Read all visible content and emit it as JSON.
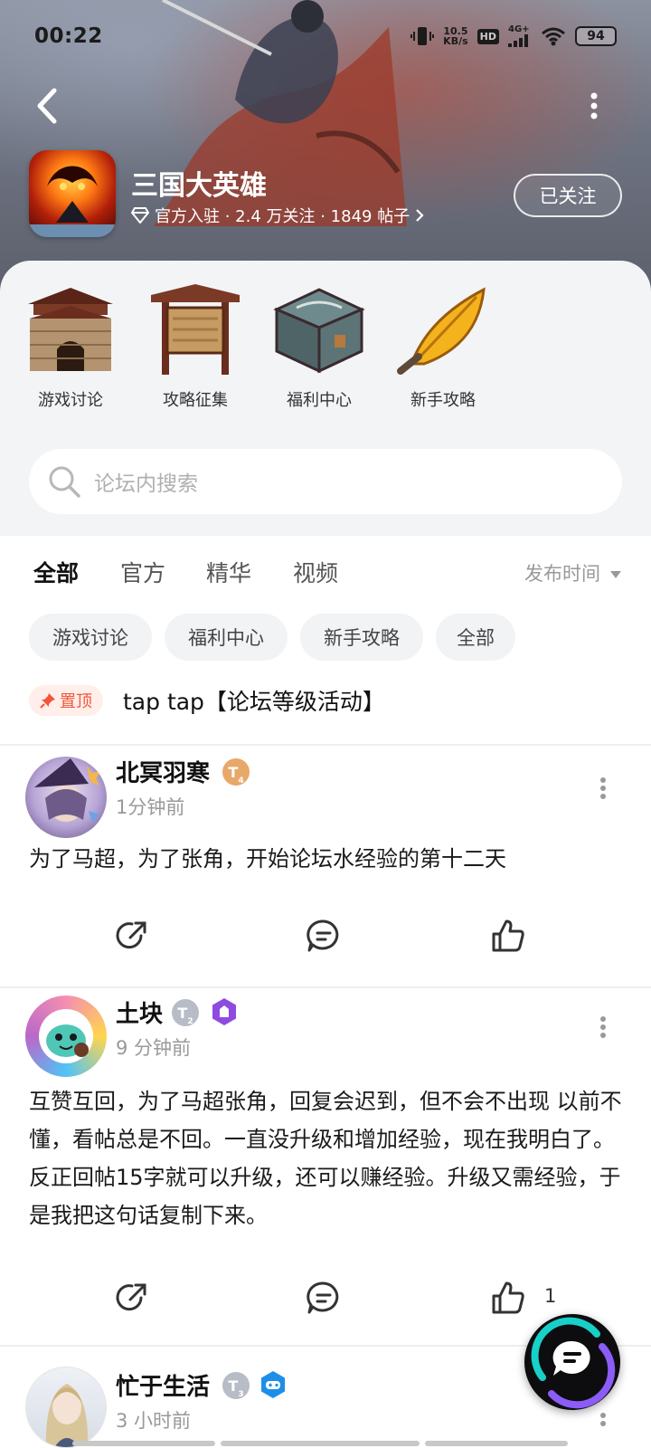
{
  "status_bar": {
    "time": "00:22",
    "net_speed_value": "10.5",
    "net_speed_unit": "KB/s",
    "hd_label": "HD",
    "signal_label": "4G+",
    "battery": "94"
  },
  "forum": {
    "title": "三国大英雄",
    "meta": "官方入驻 · 2.4 万关注 · 1849 帖子",
    "follow_label": "已关注"
  },
  "quick_links": [
    {
      "label": "游戏讨论",
      "icon": "city-gate-icon"
    },
    {
      "label": "攻略征集",
      "icon": "notice-board-icon"
    },
    {
      "label": "福利中心",
      "icon": "treasure-chest-icon"
    },
    {
      "label": "新手攻略",
      "icon": "golden-feather-icon"
    }
  ],
  "search": {
    "placeholder": "论坛内搜索"
  },
  "tabs": [
    {
      "label": "全部",
      "active": true
    },
    {
      "label": "官方",
      "active": false
    },
    {
      "label": "精华",
      "active": false
    },
    {
      "label": "视频",
      "active": false
    }
  ],
  "sort_label": "发布时间",
  "filter_chips": [
    "游戏讨论",
    "福利中心",
    "新手攻略",
    "全部"
  ],
  "pinned": {
    "badge": "置顶",
    "title": "tap tap【论坛等级活动】"
  },
  "posts": [
    {
      "author": "北冥羽寒",
      "level": "T",
      "level_num": "4",
      "time": "1分钟前",
      "body": "为了马超，为了张角，开始论坛水经验的第十二天",
      "likes": ""
    },
    {
      "author": "土块",
      "level": "T",
      "level_num": "2",
      "time": "9 分钟前",
      "body": "互赞互回，为了马超张角，回复会迟到，但不会不出现 以前不懂，看帖总是不回。一直没升级和增加经验，现在我明白了。反正回帖15字就可以升级，还可以赚经验。升级又需经验，于是我把这句话复制下来。",
      "likes": "1"
    },
    {
      "author": "忙于生活",
      "level": "T",
      "level_num": "3",
      "time": "3 小时前",
      "body": "",
      "likes": ""
    }
  ],
  "colors": {
    "accent": "#15c5ce",
    "pin_red": "#f2573a",
    "muted_text": "#999999",
    "panel_bg": "#f3f4f6"
  }
}
